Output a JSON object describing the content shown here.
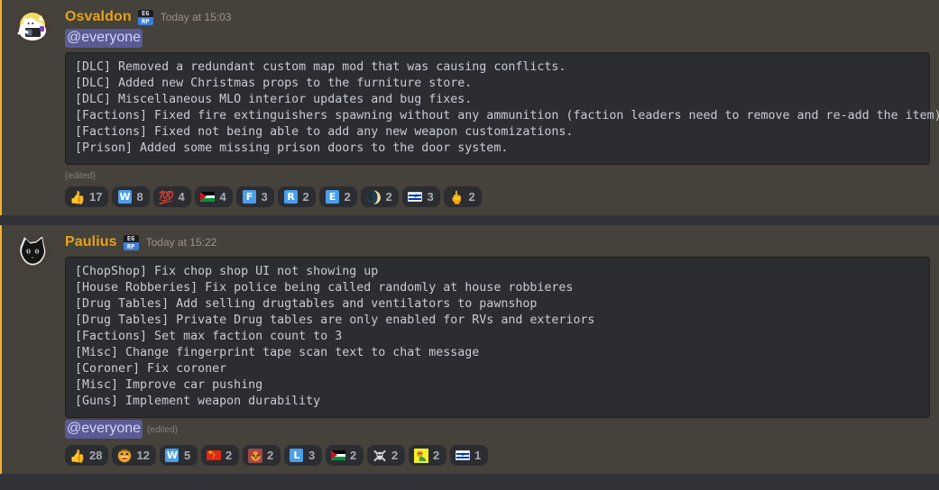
{
  "theme": {
    "mention_highlight_bg": "#45413b",
    "app_bg": "#313338",
    "accent_bar": "#f0b132",
    "username_color": "#e8a317",
    "code_bg": "#2b2d31",
    "mention_pill_bg": "#5a5a94"
  },
  "messages": [
    {
      "author": "Osvaldon",
      "server_tag_line1": "EG",
      "server_tag_line2": "RP",
      "timestamp": "Today at 15:03",
      "avatar_name": "bongo-cat-avatar",
      "mention": "@everyone",
      "mention_position": "top",
      "edited_label": "(edited)",
      "code_text": "[DLC] Removed a redundant custom map mod that was causing conflicts.\n[DLC] Added new Christmas props to the furniture store.\n[DLC] Miscellaneous MLO interior updates and bug fixes.\n[Factions] Fixed fire extinguishers spawning without any ammunition (faction leaders need to remove and re-add the item).\n[Factions] Fixed not being able to add any new weapon customizations.\n[Prison] Added some missing prison doors to the door system.",
      "reactions": [
        {
          "emoji": "thumbs-up",
          "glyph": "👍",
          "count": "17"
        },
        {
          "emoji": "regional-indicator-w",
          "glyph": "W",
          "count": "8"
        },
        {
          "emoji": "hundred-points",
          "glyph": "💯",
          "count": "4"
        },
        {
          "emoji": "flag-palestine",
          "glyph": "",
          "count": "4"
        },
        {
          "emoji": "regional-indicator-f",
          "glyph": "F",
          "count": "3"
        },
        {
          "emoji": "regional-indicator-r",
          "glyph": "R",
          "count": "2"
        },
        {
          "emoji": "regional-indicator-e",
          "glyph": "E",
          "count": "2"
        },
        {
          "emoji": "euro-moon",
          "glyph": "🌒",
          "count": "2"
        },
        {
          "emoji": "flag-israel",
          "glyph": "",
          "count": "3"
        },
        {
          "emoji": "middle-finger",
          "glyph": "🖕",
          "count": "2"
        }
      ]
    },
    {
      "author": "Paulius",
      "server_tag_line1": "EG",
      "server_tag_line2": "RP",
      "timestamp": "Today at 15:22",
      "avatar_name": "black-cat-avatar",
      "mention": "@everyone",
      "mention_position": "bottom",
      "edited_label": "(edited)",
      "code_text": "[ChopShop] Fix chop shop UI not showing up\n[House Robberies] Fix police being called randomly at house robbieres\n[Drug Tables] Add selling drugtables and ventilators to pawnshop\n[Drug Tables] Private Drug tables are only enabled for RVs and exteriors\n[Factions] Set max faction count to 3\n[Misc] Change fingerprint tape scan text to chat message\n[Coroner] Fix coroner\n[Misc] Improve car pushing\n[Guns] Implement weapon durability",
      "reactions": [
        {
          "emoji": "thumbs-up",
          "glyph": "👍",
          "count": "28"
        },
        {
          "emoji": "laughing-custom",
          "glyph": "😂",
          "count": "12"
        },
        {
          "emoji": "regional-indicator-w",
          "glyph": "W",
          "count": "5"
        },
        {
          "emoji": "flag-china",
          "glyph": "",
          "count": "2"
        },
        {
          "emoji": "clown-custom",
          "glyph": "🤡",
          "count": "2"
        },
        {
          "emoji": "regional-indicator-l",
          "glyph": "L",
          "count": "3"
        },
        {
          "emoji": "flag-palestine",
          "glyph": "",
          "count": "2"
        },
        {
          "emoji": "skull-crossbones",
          "glyph": "☠",
          "count": "2"
        },
        {
          "emoji": "custom-green-emoji",
          "glyph": "🤢",
          "count": "2"
        },
        {
          "emoji": "flag-israel",
          "glyph": "",
          "count": "1"
        }
      ]
    }
  ]
}
